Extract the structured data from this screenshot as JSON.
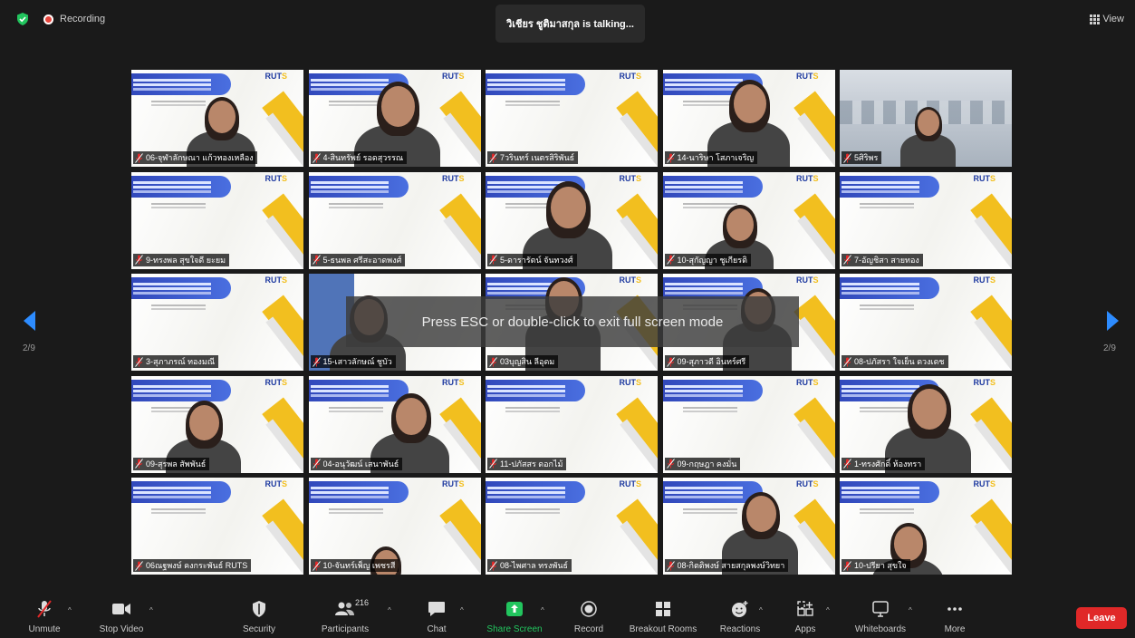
{
  "top": {
    "recording_label": "Recording",
    "talking_text": "วิเชียร ชูติมาสกุล is talking...",
    "view_label": "View"
  },
  "pager": {
    "left": "2/9",
    "right": "2/9"
  },
  "toast": "Press ESC or double-click to exit full screen mode",
  "tiles": [
    "06-จุฬาลักษณา แก้วทองเหลือง",
    "4-สินทรัพย์ รอดสุวรรณ",
    "7วรินทร์ เนตรสิริพันธ์",
    "14-นาริษา โสภาเจริญ",
    "5ศิริพร",
    "9-ทรงพล สุขใจดี ยะยม",
    "5-ธนพล ศรีสะอาดพงศ์",
    "5-ดารารัตน์ จันทวงศ์",
    "10-สุกัญญา ชูเกียรติ",
    "7-อัญชิสา สายทอง",
    "3-สุภาภรณ์ ทองมณี",
    "15-เสาวลักษณ์ ชูบัว",
    "03บุญสิน ลีอุดม",
    "09-สุภาวดี อินทร์ศรี",
    "08-ปภัสรา ใจเย็น ดวงเดช",
    "09-สุรพล สัพพันธ์",
    "04-อนุวัฒน์ เสนาพันธ์",
    "11-ปภัสสร ดอกไม้",
    "09-กฤษฎา คงมั่น",
    "1-ทรงศักดิ์ ห้องทรา",
    "06ณฐพงษ์ คงกระพันธ์ RUTS",
    "10-จันทร์เพ็ญ เพชรสี",
    "08-ไพศาล ทรงพันธ์",
    "08-กิตติพงษ์ สายสกุลพงษ์วิทยา",
    "10-ปรียา สุขใจ"
  ],
  "toolbar": {
    "unmute": "Unmute",
    "stop_video": "Stop Video",
    "security": "Security",
    "participants": "Participants",
    "participants_count": "216",
    "chat": "Chat",
    "share_screen": "Share Screen",
    "record": "Record",
    "breakout": "Breakout Rooms",
    "reactions": "Reactions",
    "apps": "Apps",
    "whiteboards": "Whiteboards",
    "more": "More",
    "leave": "Leave"
  },
  "colors": {
    "accent_green": "#22c55e",
    "leave_red": "#e02828",
    "slide_yellow": "#f2bf1f",
    "slide_blue": "#2f45b8"
  }
}
